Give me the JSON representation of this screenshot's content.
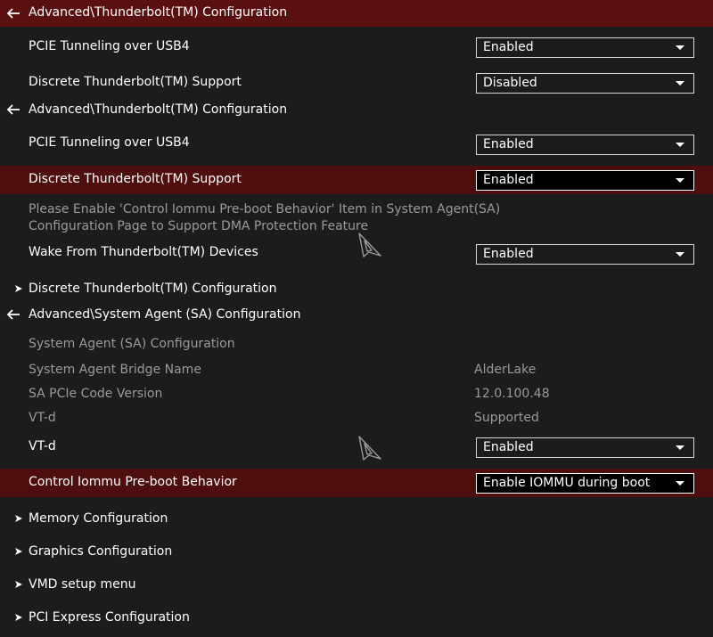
{
  "section1": {
    "path": "Advanced\\Thunderbolt(TM) Configuration",
    "pcie_tunneling": {
      "label": "PCIE Tunneling over USB4",
      "value": "Enabled"
    },
    "discrete_tb_support": {
      "label": "Discrete Thunderbolt(TM) Support",
      "value": "Disabled"
    }
  },
  "section2": {
    "path": "Advanced\\Thunderbolt(TM) Configuration",
    "pcie_tunneling": {
      "label": "PCIE Tunneling over USB4",
      "value": "Enabled"
    },
    "discrete_tb_support": {
      "label": "Discrete Thunderbolt(TM) Support",
      "value": "Enabled"
    },
    "notice_line1": "Please Enable 'Control Iommu Pre-boot Behavior' Item in System Agent(SA)",
    "notice_line2": "Configuration Page to Support DMA Protection Feature",
    "wake_from_tb": {
      "label": "Wake From Thunderbolt(TM) Devices",
      "value": "Enabled"
    },
    "discrete_tb_config": {
      "label": "Discrete Thunderbolt(TM) Configuration"
    }
  },
  "section3": {
    "path": "Advanced\\System Agent (SA) Configuration",
    "heading": "System Agent (SA) Configuration",
    "bridge_name": {
      "label": "System Agent Bridge Name",
      "value": "AlderLake"
    },
    "pcie_code_version": {
      "label": "SA PCIe Code Version",
      "value": "12.0.100.48"
    },
    "vtd_status": {
      "label": "VT-d",
      "value": "Supported"
    },
    "vtd": {
      "label": "VT-d",
      "value": "Enabled"
    },
    "iommu_preboot": {
      "label": "Control Iommu Pre-boot Behavior",
      "value": "Enable IOMMU during boot"
    },
    "submenus": [
      {
        "label": "Memory Configuration"
      },
      {
        "label": "Graphics Configuration"
      },
      {
        "label": "VMD setup menu"
      },
      {
        "label": "PCI Express Configuration"
      }
    ]
  },
  "colors": {
    "background": "#1c1c1c",
    "path_bar": "#5a1010",
    "highlight": "#4e0e0e",
    "text": "#ffffff",
    "muted_text": "#9a9a9a"
  },
  "icons": {
    "back": "arrow-left-icon",
    "submenu": "chevron-right-icon",
    "pointer": "mouse-cursor-icon"
  }
}
